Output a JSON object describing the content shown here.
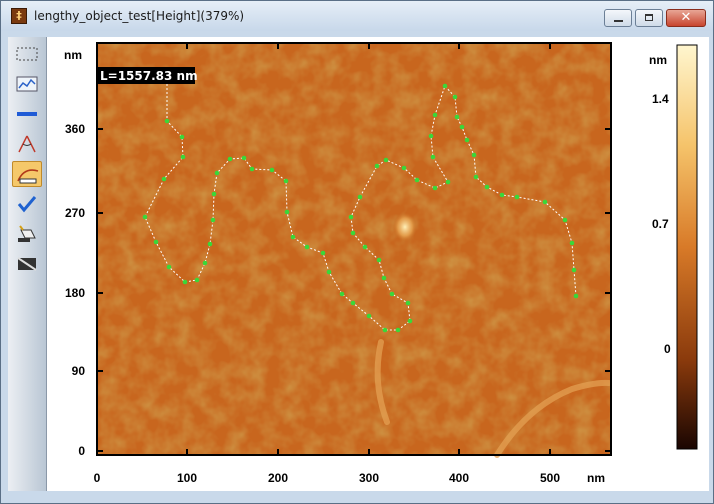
{
  "window": {
    "title": "lengthy_object_test[Height](379%)",
    "app_icon_glyph": "‡",
    "close_glyph": "✕"
  },
  "toolbar": {
    "tools": [
      {
        "name": "rectangle-select-icon"
      },
      {
        "name": "profile-chart-icon"
      },
      {
        "name": "line-tool-icon"
      },
      {
        "name": "angle-measure-icon"
      },
      {
        "name": "length-measure-icon",
        "active": true
      },
      {
        "name": "check-icon"
      },
      {
        "name": "eraser-icon"
      },
      {
        "name": "display-toggle-icon"
      }
    ]
  },
  "image_plot": {
    "x_unit": "nm",
    "y_unit": "nm",
    "x_ticks": [
      "0",
      "100",
      "200",
      "300",
      "400",
      "500"
    ],
    "y_ticks": [
      "0",
      "90",
      "180",
      "270",
      "360"
    ],
    "measurement_label": "L=1557.83 nm"
  },
  "colorbar": {
    "unit": "nm",
    "ticks": [
      "1.4",
      "0.7",
      "0"
    ],
    "colors": [
      "#fff6cf",
      "#f5c36a",
      "#d87a28",
      "#8a3a0c",
      "#1a0602"
    ]
  },
  "colors": {
    "trace_dot": "#39d839",
    "label_bg": "#000000",
    "label_text": "#ffffff"
  }
}
